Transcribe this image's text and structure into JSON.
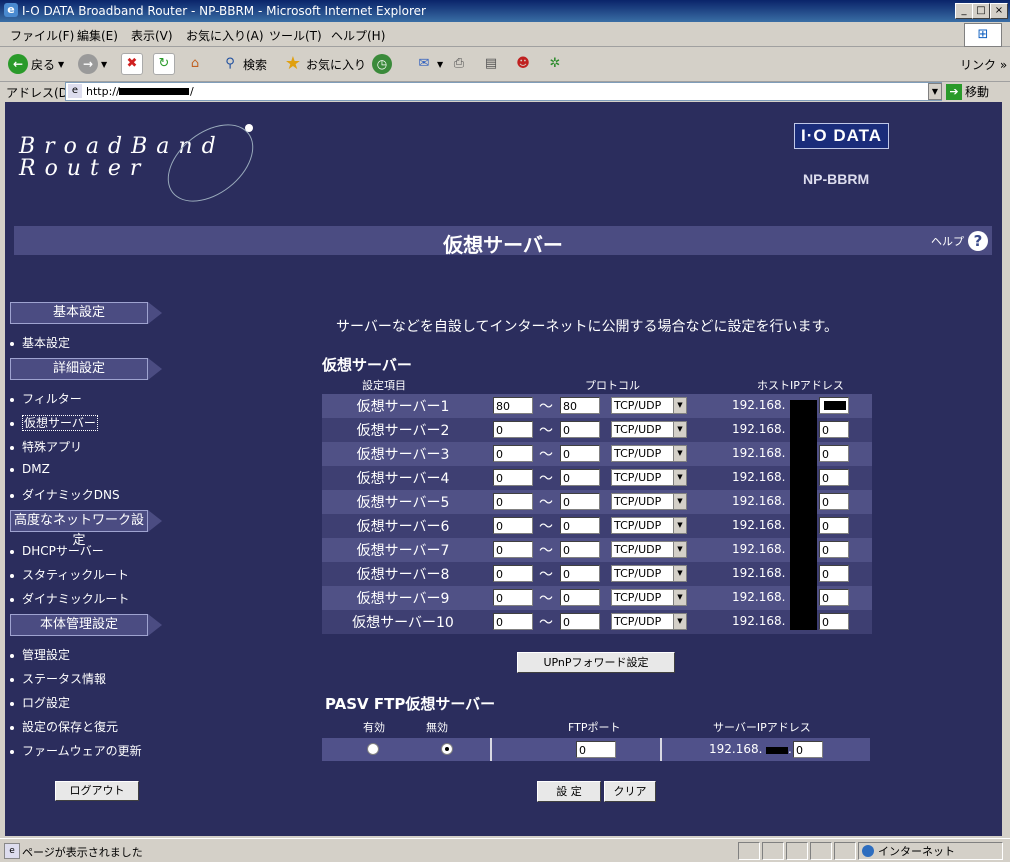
{
  "window": {
    "title": "I-O DATA Broadband Router - NP-BBRM - Microsoft Internet Explorer"
  },
  "menu": [
    "ファイル(F)",
    "編集(E)",
    "表示(V)",
    "お気に入り(A)",
    "ツール(T)",
    "ヘルプ(H)"
  ],
  "toolbar": {
    "back": "戻る",
    "search": "検索",
    "favorites": "お気に入り",
    "links": "リンク »"
  },
  "address": {
    "label": "アドレス(D)",
    "prefix": "http://",
    "suffix": "/",
    "go": "移動"
  },
  "header": {
    "logo_line1": "BroadBand",
    "logo_line2": "Router",
    "brand": "I·O DATA",
    "model": "NP-BBRM",
    "page_title": "仮想サーバー",
    "help": "ヘルプ"
  },
  "nav": {
    "sec_basic": "基本設定",
    "basic": "基本設定",
    "sec_detail": "詳細設定",
    "filter": "フィルター",
    "virtual": "仮想サーバー",
    "special": "特殊アプリ",
    "dmz": "DMZ",
    "ddns": "ダイナミックDNS",
    "sec_advanced": "高度なネットワーク設定",
    "dhcp": "DHCPサーバー",
    "static": "スタティックルート",
    "dynamic": "ダイナミックルート",
    "sec_admin": "本体管理設定",
    "admin": "管理設定",
    "status": "ステータス情報",
    "log": "ログ設定",
    "save": "設定の保存と復元",
    "firmware": "ファームウェアの更新",
    "logout": "ログアウト"
  },
  "main": {
    "description": "サーバーなどを自設してインターネットに公開する場合などに設定を行います。",
    "vs_title": "仮想サーバー",
    "col_item": "設定項目",
    "col_proto": "プロトコル",
    "col_host": "ホストIPアドレス",
    "tilde": "～",
    "ip_prefix": "192.168.",
    "rows": [
      {
        "name": "仮想サーバー1",
        "from": "80",
        "to": "80",
        "proto": "TCP/UDP",
        "last": ""
      },
      {
        "name": "仮想サーバー2",
        "from": "0",
        "to": "0",
        "proto": "TCP/UDP",
        "last": "0"
      },
      {
        "name": "仮想サーバー3",
        "from": "0",
        "to": "0",
        "proto": "TCP/UDP",
        "last": "0"
      },
      {
        "name": "仮想サーバー4",
        "from": "0",
        "to": "0",
        "proto": "TCP/UDP",
        "last": "0"
      },
      {
        "name": "仮想サーバー5",
        "from": "0",
        "to": "0",
        "proto": "TCP/UDP",
        "last": "0"
      },
      {
        "name": "仮想サーバー6",
        "from": "0",
        "to": "0",
        "proto": "TCP/UDP",
        "last": "0"
      },
      {
        "name": "仮想サーバー7",
        "from": "0",
        "to": "0",
        "proto": "TCP/UDP",
        "last": "0"
      },
      {
        "name": "仮想サーバー8",
        "from": "0",
        "to": "0",
        "proto": "TCP/UDP",
        "last": "0"
      },
      {
        "name": "仮想サーバー9",
        "from": "0",
        "to": "0",
        "proto": "TCP/UDP",
        "last": "0"
      },
      {
        "name": "仮想サーバー10",
        "from": "0",
        "to": "0",
        "proto": "TCP/UDP",
        "last": "0"
      }
    ],
    "upnp": "UPnPフォワード設定",
    "pasv_title": "PASV FTP仮想サーバー",
    "enable": "有効",
    "disable": "無効",
    "ftp_port": "FTPポート",
    "server_ip": "サーバーIPアドレス",
    "ftp_port_value": "0",
    "ftp_ip_last": "0",
    "set": "設 定",
    "clear": "クリア"
  },
  "status": {
    "text": "ページが表示されました",
    "zone": "インターネット"
  }
}
